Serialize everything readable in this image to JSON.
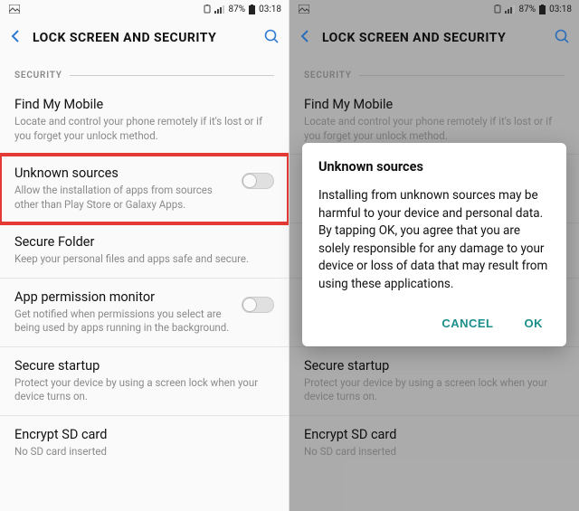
{
  "status": {
    "battery_pct": "87%",
    "time": "03:18"
  },
  "header": {
    "title": "LOCK SCREEN AND SECURITY"
  },
  "section": {
    "label": "SECURITY"
  },
  "items": {
    "find_my_mobile": {
      "title": "Find My Mobile",
      "desc": "Locate and control your phone remotely if it's lost or if you forget your unlock method."
    },
    "unknown_sources": {
      "title": "Unknown sources",
      "desc": "Allow the installation of apps from sources other than Play Store or Galaxy Apps."
    },
    "secure_folder": {
      "title": "Secure Folder",
      "desc": "Keep your personal files and apps safe and secure."
    },
    "app_permission_monitor": {
      "title": "App permission monitor",
      "desc": "Get notified when permissions you select are being used by apps running in the background."
    },
    "secure_startup": {
      "title": "Secure startup",
      "desc": "Protect your device by using a screen lock when your device turns on."
    },
    "encrypt_sd": {
      "title": "Encrypt SD card",
      "desc": "No SD card inserted"
    }
  },
  "dialog": {
    "title": "Unknown sources",
    "body": "Installing from unknown sources may be harmful to your device and personal data. By tapping OK, you agree that you are solely responsible for any damage to your device or loss of data that may result from using these applications.",
    "cancel": "CANCEL",
    "ok": "OK"
  }
}
